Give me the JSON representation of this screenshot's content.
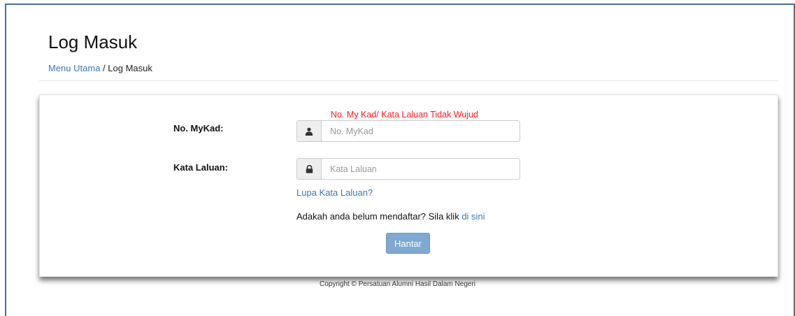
{
  "header": {
    "title": "Log Masuk",
    "breadcrumb": {
      "home": "Menu Utama",
      "separator": " / ",
      "current": "Log Masuk"
    }
  },
  "form": {
    "error": "No. My Kad/ Kata Laluan Tidak Wujud",
    "mykad": {
      "label": "No. MyKad:",
      "placeholder": "No. MyKad",
      "icon": "user-icon"
    },
    "password": {
      "label": "Kata Laluan:",
      "placeholder": "Kata Laluan",
      "icon": "lock-icon"
    },
    "forgot_link": "Lupa Kata Laluan?",
    "register_prompt": "Adakah anda belum mendaftar? Sila klik ",
    "register_link": "di sini",
    "submit_label": "Hantar"
  },
  "footer": {
    "copyright": "Copyright © Persatuan Alumni Hasil Dalam Negeri"
  },
  "colors": {
    "link": "#3d78b3",
    "error": "#ff1a1a",
    "button": "#7fa9d1"
  }
}
